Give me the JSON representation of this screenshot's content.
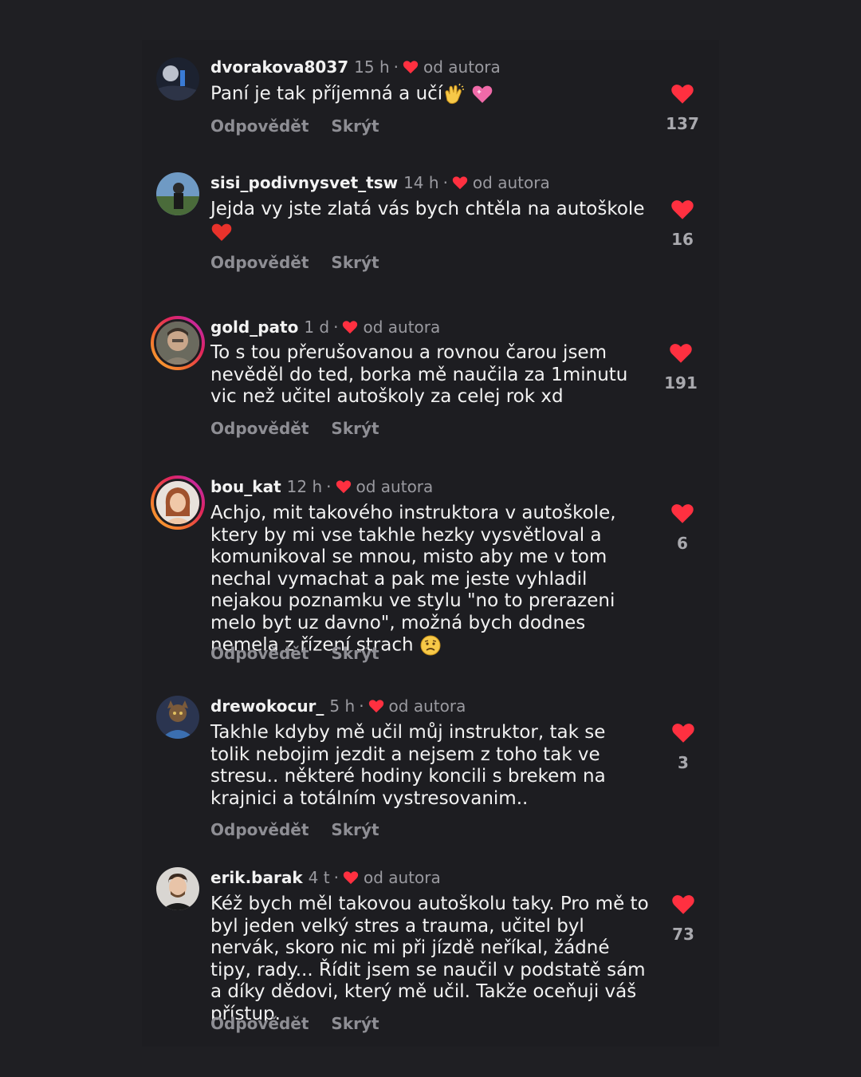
{
  "comments": [
    {
      "username": "dvorakova8037",
      "time": "15 h",
      "separator": "·",
      "author_label": "od autora",
      "text": "Paní je tak příjemná a učí",
      "emojis": [
        "clapping-hands",
        "sparkling-heart"
      ],
      "reply_label": "Odpovědět",
      "hide_label": "Skrýt",
      "likes": "137"
    },
    {
      "username": "sisi_podivnysvet_tsw",
      "time": "14 h",
      "separator": "·",
      "author_label": "od autora",
      "text": "Jejda vy jste zlatá vás bych chtěla na autoškole",
      "emojis": [
        "red-heart"
      ],
      "reply_label": "Odpovědět",
      "hide_label": "Skrýt",
      "likes": "16"
    },
    {
      "username": "gold_pato",
      "time": "1 d",
      "separator": "·",
      "author_label": "od autora",
      "text": "To s tou přerušovanou a rovnou čarou jsem nevěděl do ted, borka mě naučila za 1minutu vic než učitel autoškoly za celej rok xd",
      "emojis": [],
      "reply_label": "Odpovědět",
      "hide_label": "Skrýt",
      "likes": "191"
    },
    {
      "username": "bou_kat",
      "time": "12 h",
      "separator": "·",
      "author_label": "od autora",
      "text": "Achjo, mit takového instruktora v autoškole, ktery by mi vse takhle hezky vysvětloval a komunikoval se mnou, misto aby me v tom nechal vymachat a pak me jeste vyhladil nejakou poznamku ve stylu \"no to prerazeni melo byt uz davno\", možná bych dodnes nemela z řízení strach",
      "emojis": [
        "worried-face"
      ],
      "reply_label": "Odpovědět",
      "hide_label": "Skrýt",
      "likes": "6"
    },
    {
      "username": "drewokocur_",
      "time": "5 h",
      "separator": "·",
      "author_label": "od autora",
      "text": "Takhle kdyby mě učil můj instruktor, tak se tolik nebojim jezdit a nejsem z toho tak ve stresu.. některé hodiny koncili s brekem na krajnici a totálním vystresovanim..",
      "emojis": [],
      "reply_label": "Odpovědět",
      "hide_label": "Skrýt",
      "likes": "3"
    },
    {
      "username": "erik.barak",
      "time": "4 t",
      "separator": "·",
      "author_label": "od autora",
      "text": "Kéž bych měl takovou autoškolu taky. Pro mě to byl jeden velký stres a trauma, učitel byl nervák, skoro nic mi při jízdě neříkal, žádné tipy, rady... Řídit jsem se naučil v podstatě sám a díky dědovi, který mě učil. Takže oceňuji váš přístup.",
      "emojis": [],
      "reply_label": "Odpovědět",
      "hide_label": "Skrýt",
      "likes": "73"
    }
  ],
  "colors": {
    "heart": "#ff3040",
    "background": "#1f1f23",
    "muted": "#9a9aa0"
  }
}
